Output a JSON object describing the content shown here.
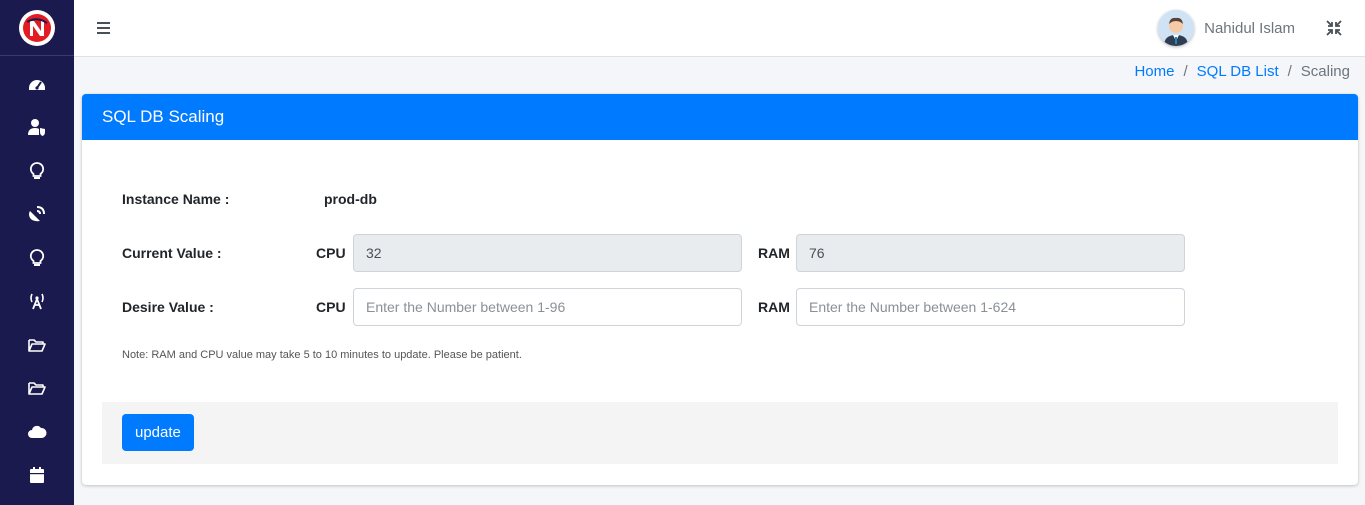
{
  "sidebar": {
    "brand_icon": "n-logo-icon",
    "items": [
      {
        "icon": "dashboard-gauge-icon"
      },
      {
        "icon": "user-shield-icon"
      },
      {
        "icon": "lightbulb-icon"
      },
      {
        "icon": "satellite-dish-icon"
      },
      {
        "icon": "lightbulb-icon"
      },
      {
        "icon": "broadcast-tower-icon"
      },
      {
        "icon": "folder-open-icon"
      },
      {
        "icon": "folder-open-icon"
      },
      {
        "icon": "cloud-icon"
      },
      {
        "icon": "calendar-icon"
      }
    ],
    "bg_color": "#1a1a4e"
  },
  "topbar": {
    "user_name": "Nahidul Islam"
  },
  "breadcrumb": {
    "home": "Home",
    "list": "SQL DB List",
    "current": "Scaling"
  },
  "card": {
    "title": "SQL DB Scaling",
    "header_color": "#007bff",
    "instance_label": "Instance Name :",
    "instance_value": "prod-db",
    "current_label": "Current Value :",
    "desire_label": "Desire Value :",
    "cpu_label": "CPU",
    "ram_label": "RAM",
    "current_cpu": "32",
    "current_ram": "76",
    "desire_cpu_placeholder": "Enter the Number between 1-96",
    "desire_ram_placeholder": "Enter the Number between 1-624",
    "note": "Note: RAM and CPU value may take 5 to 10 minutes to update. Please be patient.",
    "update_button": "update"
  }
}
